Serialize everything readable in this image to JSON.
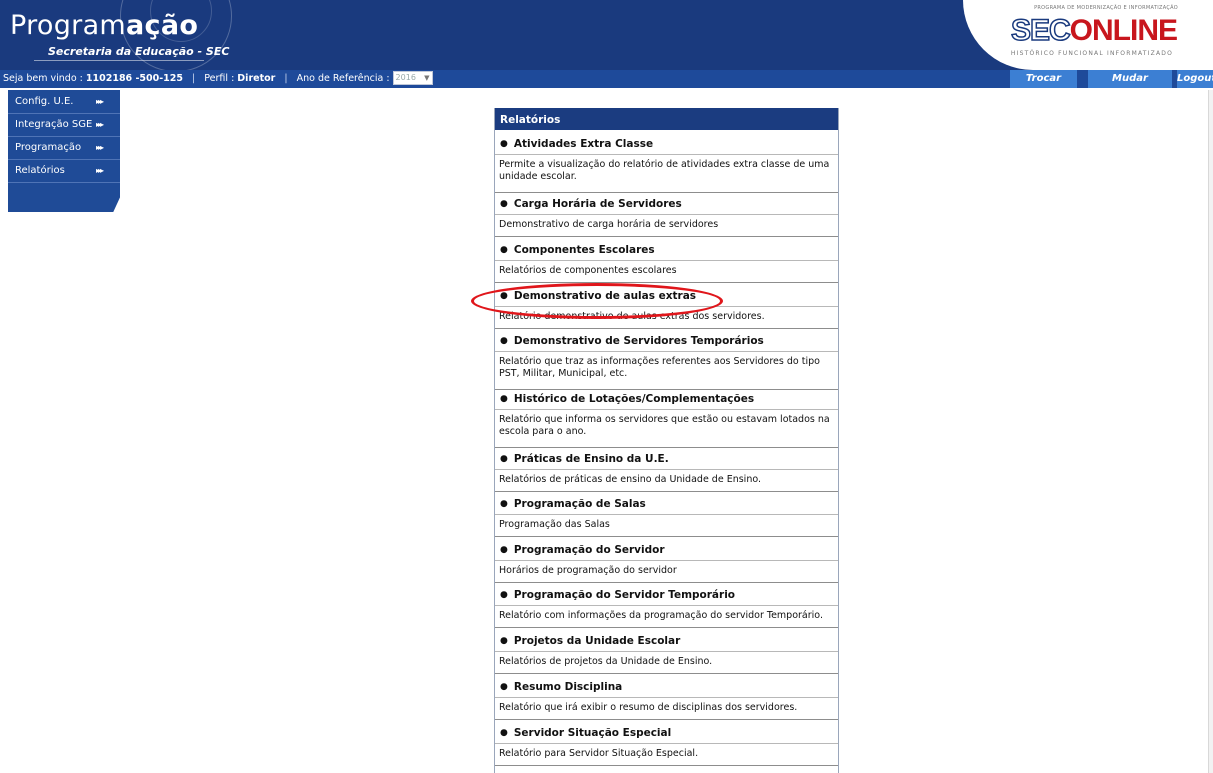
{
  "header": {
    "title_light": "Program",
    "title_bold": "ação",
    "subtitle": "Secretaria da Educação - SEC"
  },
  "logo": {
    "top_text": "PROGRAMA DE MODERNIZAÇÃO E INFORMATIZAÇÃO",
    "sec": "SEC",
    "online": "ONLINE",
    "sub_text": "HISTÓRICO FUNCIONAL INFORMATIZADO"
  },
  "topbar": {
    "welcome_label": "Seja bem vindo :",
    "user_id": "1102186 -500-125",
    "separator": "|",
    "profile_label": "Perfil :",
    "profile_value": "Diretor",
    "year_label": "Ano de Referência :",
    "year_value": "2016",
    "buttons": [
      "Trocar Senha",
      "Mudar Sistema",
      "Logout"
    ]
  },
  "sidebar": {
    "arrow_glyph": "▸▸▸",
    "items": [
      {
        "label": "Config. U.E."
      },
      {
        "label": "Integração SGE"
      },
      {
        "label": "Programação"
      },
      {
        "label": "Relatórios"
      }
    ]
  },
  "panel": {
    "title": "Relatórios",
    "bullet": "●",
    "items": [
      {
        "title": "Atividades Extra Classe",
        "desc": "Permite a visualização do relatório de atividades extra classe de uma unidade escolar."
      },
      {
        "title": "Carga Horária de Servidores",
        "desc": "Demonstrativo de carga horária de servidores"
      },
      {
        "title": "Componentes Escolares",
        "desc": "Relatórios de componentes escolares"
      },
      {
        "title": "Demonstrativo de aulas extras",
        "desc": "Relatório demonstrativo de aulas extras dos servidores."
      },
      {
        "title": "Demonstrativo de Servidores Temporários",
        "desc": "Relatório que traz as informações referentes aos Servidores do tipo PST, Militar, Municipal, etc."
      },
      {
        "title": "Histórico de Lotações/Complementações",
        "desc": "Relatório que informa os servidores que estão ou estavam lotados na escola para o ano."
      },
      {
        "title": "Práticas de Ensino da U.E.",
        "desc": "Relatórios de práticas de ensino da Unidade de Ensino."
      },
      {
        "title": "Programação de Salas",
        "desc": "Programação das Salas"
      },
      {
        "title": "Programação do Servidor",
        "desc": "Horários de programação do servidor"
      },
      {
        "title": "Programação do Servidor Temporário",
        "desc": "Relatório com informações da programação do servidor Temporário."
      },
      {
        "title": "Projetos da Unidade Escolar",
        "desc": "Relatórios de projetos da Unidade de Ensino."
      },
      {
        "title": "Resumo Disciplina",
        "desc": "Relatório que irá exibir o resumo de disciplinas dos servidores."
      },
      {
        "title": "Servidor Situação Especial",
        "desc": "Relatório para Servidor Situação Especial."
      }
    ]
  }
}
